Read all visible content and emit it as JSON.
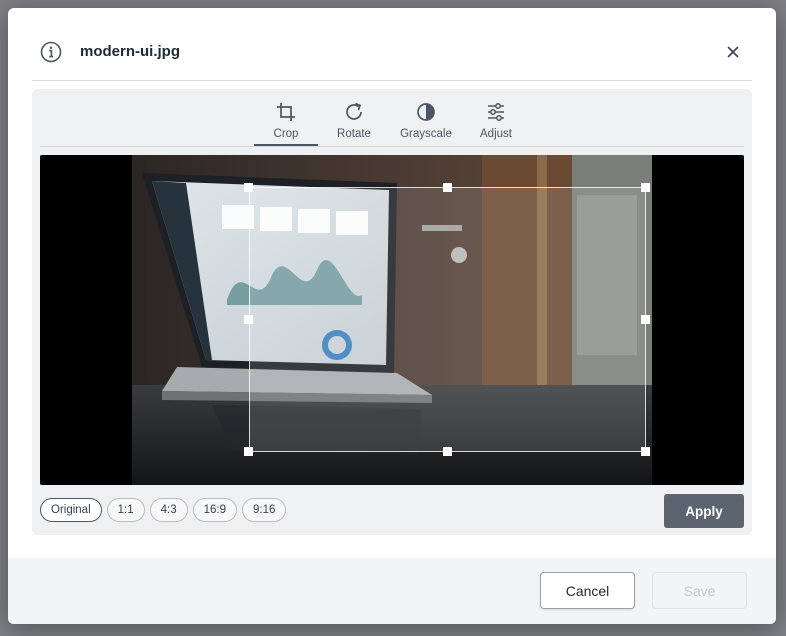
{
  "dialog": {
    "title": "modern-ui.jpg"
  },
  "toolbar": {
    "tabs": [
      {
        "label": "Crop",
        "icon": "crop-icon",
        "active": true
      },
      {
        "label": "Rotate",
        "icon": "rotate-icon",
        "active": false
      },
      {
        "label": "Grayscale",
        "icon": "grayscale-icon",
        "active": false
      },
      {
        "label": "Adjust",
        "icon": "sliders-icon",
        "active": false
      }
    ]
  },
  "aspect_ratios": {
    "options": [
      "Original",
      "1:1",
      "4:3",
      "16:9",
      "9:16"
    ],
    "selected": "Original"
  },
  "actions": {
    "apply_label": "Apply",
    "cancel_label": "Cancel",
    "save_label": "Save"
  },
  "colors": {
    "apply_bg": "#5c6470",
    "overlay": "#7d7f83",
    "panel_bg": "#eff0f2"
  }
}
